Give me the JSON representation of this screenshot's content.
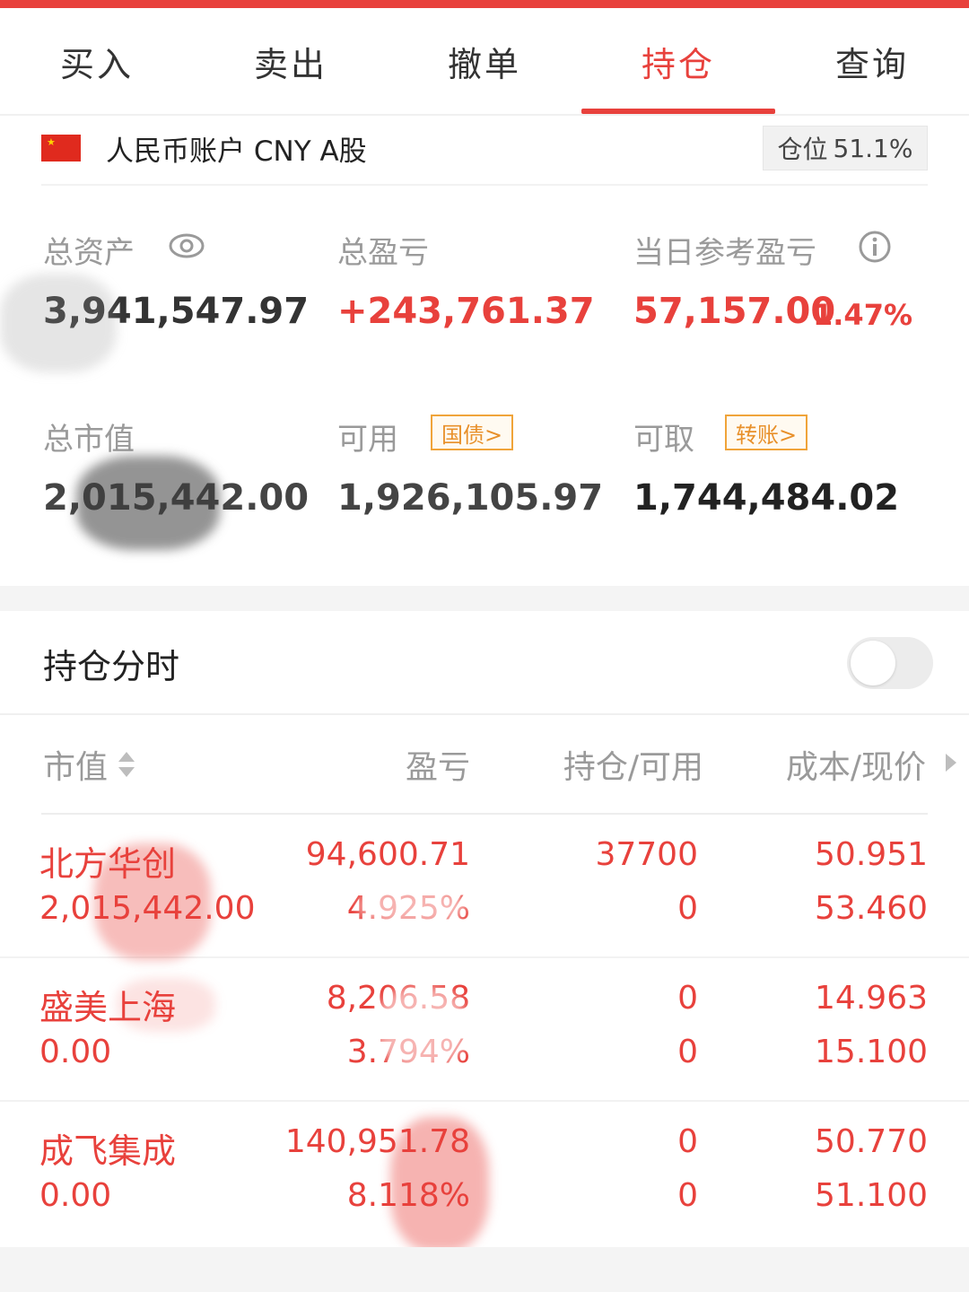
{
  "tabs": [
    {
      "label": "买入",
      "active": false
    },
    {
      "label": "卖出",
      "active": false
    },
    {
      "label": "撤单",
      "active": false
    },
    {
      "label": "持仓",
      "active": true
    },
    {
      "label": "查询",
      "active": false
    }
  ],
  "account": {
    "flag_icon": "china-flag-icon",
    "label": "人民币账户 CNY A股",
    "position_label": "仓位",
    "position_value": "51.1%"
  },
  "summary": {
    "total_assets_label": "总资产",
    "total_assets_value": "3,941,547.97",
    "total_pl_label": "总盈亏",
    "total_pl_value": "+243,761.37",
    "daily_pl_label": "当日参考盈亏",
    "daily_pl_value": "57,157.00",
    "daily_pl_pct": "1.47%",
    "market_value_label": "总市值",
    "market_value_value": "2,015,442.00",
    "available_label": "可用",
    "available_pill": "国债>",
    "available_value": "1,926,105.97",
    "withdrawable_label": "可取",
    "withdrawable_pill": "转账>",
    "withdrawable_value": "1,744,484.02"
  },
  "holdings_timeshare": {
    "title": "持仓分时",
    "toggle_on": false
  },
  "table": {
    "headers": [
      "市值",
      "盈亏",
      "持仓/可用",
      "成本/现价"
    ],
    "rows": [
      {
        "name": "北方华创",
        "market_value": "2,015,442.00",
        "pl": "94,600.71",
        "pl_pct": "4.925%",
        "position": "37700",
        "available": "0",
        "cost": "50.951",
        "price": "53.460"
      },
      {
        "name": "盛美上海",
        "market_value": "0.00",
        "pl": "8,206.58",
        "pl_pct": "3.794%",
        "position": "0",
        "available": "0",
        "cost": "14.963",
        "price": "15.100"
      },
      {
        "name": "成飞集成",
        "market_value": "0.00",
        "pl": "140,951.78",
        "pl_pct": "8.118%",
        "position": "0",
        "available": "0",
        "cost": "50.770",
        "price": "51.100"
      }
    ]
  },
  "colors": {
    "accent": "#e8413c",
    "muted": "#9a9a9a",
    "pill": "#f0a43a"
  }
}
